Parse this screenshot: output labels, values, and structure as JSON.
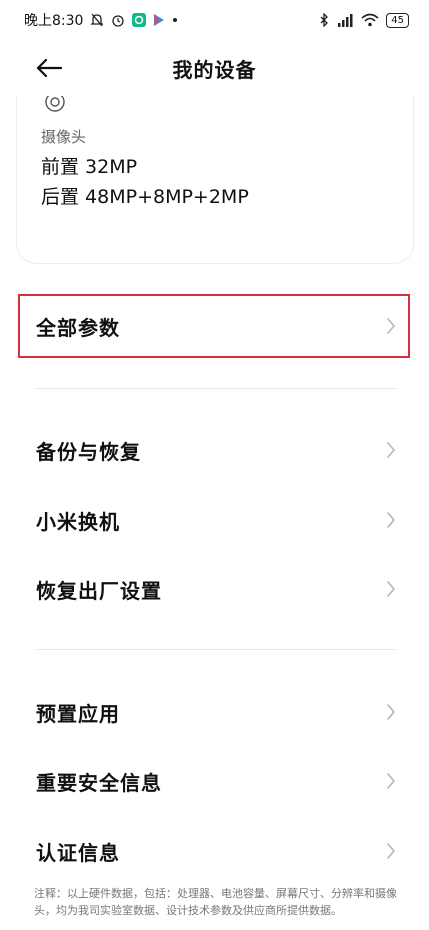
{
  "statusbar": {
    "time": "晚上8:30",
    "battery": "45"
  },
  "header": {
    "title": "我的设备"
  },
  "camera": {
    "label": "摄像头",
    "front": "前置 32MP",
    "rear": "后置 48MP+8MP+2MP"
  },
  "menu": {
    "all_params": "全部参数",
    "backup": "备份与恢复",
    "mi_mover": "小米换机",
    "factory_reset": "恢复出厂设置",
    "preinstalled": "预置应用",
    "safety_info": "重要安全信息",
    "certification": "认证信息"
  },
  "footnote": "注释：以上硬件数据，包括：处理器、电池容量、屏幕尺寸、分辨率和摄像头，均为我司实验室数据、设计技术参数及供应商所提供数据。",
  "colors": {
    "highlight": "#d8303a",
    "divider": "#e6e6e6",
    "chevron": "#b5b5b5"
  }
}
